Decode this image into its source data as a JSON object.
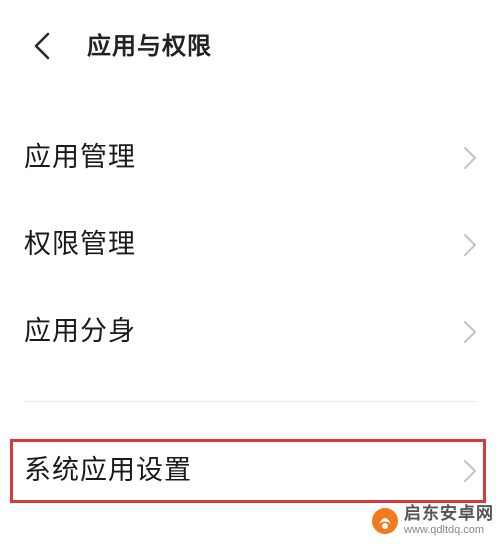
{
  "header": {
    "title": "应用与权限",
    "back_icon": "chevron-left-icon"
  },
  "menu": {
    "items": [
      {
        "label": "应用管理",
        "icon": "chevron-right-icon"
      },
      {
        "label": "权限管理",
        "icon": "chevron-right-icon"
      },
      {
        "label": "应用分身",
        "icon": "chevron-right-icon"
      },
      {
        "label": "系统应用设置",
        "icon": "chevron-right-icon",
        "highlighted": true
      }
    ]
  },
  "colors": {
    "highlight_border": "#d63a3a",
    "chevron": "#c4c4c4",
    "text": "#1a1a1a",
    "logo_orange": "#f07b1e"
  },
  "watermark": {
    "name": "启东安卓网",
    "url": "www.qdltdq.com"
  }
}
